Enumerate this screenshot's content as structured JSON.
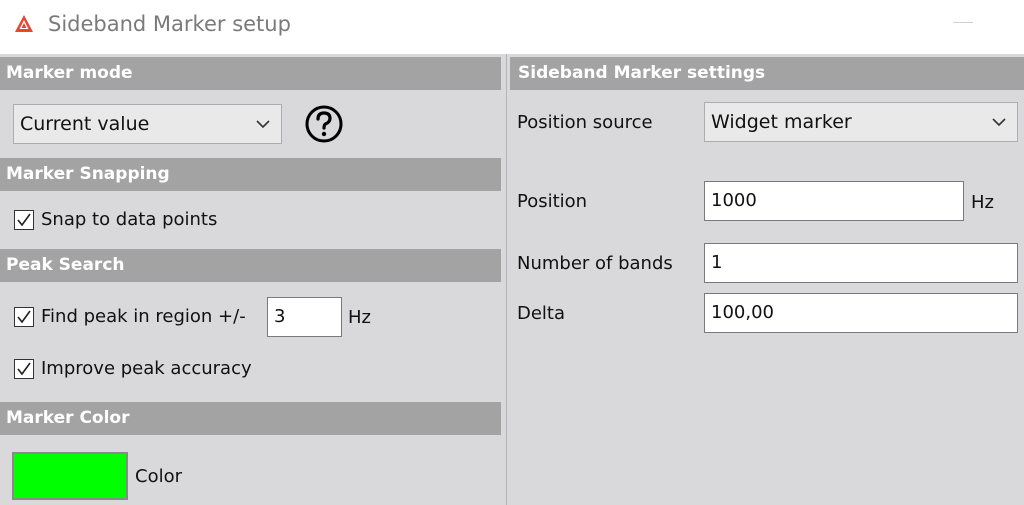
{
  "window": {
    "title": "Sideband Marker setup"
  },
  "marker_mode": {
    "header": "Marker mode",
    "selected": "Current value"
  },
  "snapping": {
    "header": "Marker Snapping",
    "snap_label": "Snap to data points",
    "snap_checked": true
  },
  "peak_search": {
    "header": "Peak Search",
    "find_peak_label": "Find peak in region +/-",
    "find_peak_checked": true,
    "region_value": "3",
    "region_unit": "Hz",
    "improve_label": "Improve peak accuracy",
    "improve_checked": true
  },
  "marker_color": {
    "header": "Marker Color",
    "color_label": "Color",
    "color_value": "#00ff00"
  },
  "settings": {
    "header": "Sideband Marker settings",
    "position_source_label": "Position source",
    "position_source_value": "Widget marker",
    "position_label": "Position",
    "position_value": "1000",
    "position_unit": "Hz",
    "bands_label": "Number of bands",
    "bands_value": "1",
    "delta_label": "Delta",
    "delta_value": "100,00"
  }
}
